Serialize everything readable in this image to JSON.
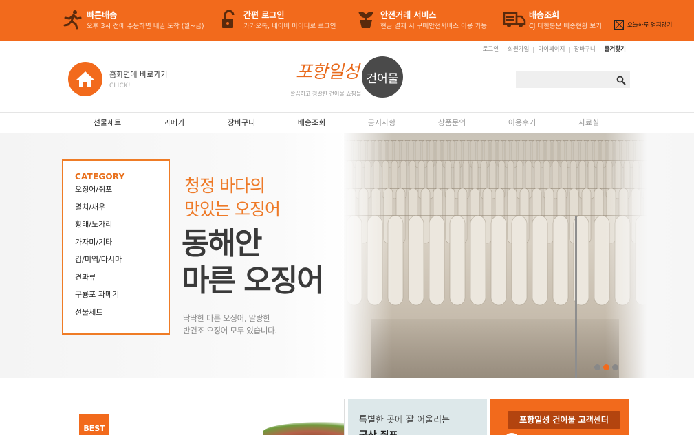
{
  "top_bar": {
    "features": [
      {
        "icon": "running-person-icon",
        "title": "빠른배송",
        "desc": "오후 3시 전에 주문하면 내일 도착 (월~금)"
      },
      {
        "icon": "padlock-icon",
        "title": "간편 로그인",
        "desc": "카카오톡, 네이버 아이디로 로그인"
      },
      {
        "icon": "plant-pot-icon",
        "title": "안전거래 서비스",
        "desc": "현금 결제 시 구매안전서비스 이용 가능"
      },
      {
        "icon": "delivery-truck-icon",
        "title": "배송조회",
        "desc": "CJ 대한통운 배송현황 보기"
      }
    ],
    "dismiss_label": "오늘하루 열지않기"
  },
  "util_links": [
    "로그인",
    "회원가입",
    "마이페이지",
    "장바구니",
    "즐겨찾기"
  ],
  "home_link": {
    "label": "홈화면에 바로가기",
    "sub": "CLICK!"
  },
  "logo": {
    "name": "포항일성",
    "badge": "건어물",
    "tagline": "깔끔하고 정갈한 건어물 쇼핑몰"
  },
  "search": {
    "placeholder": "",
    "value": ""
  },
  "nav": [
    "선물세트",
    "과메기",
    "장바구니",
    "배송조회",
    "공지사항",
    "상품문의",
    "이용후기",
    "자료실"
  ],
  "category": {
    "title": "CATEGORY",
    "items": [
      "오징어/쥐포",
      "멸치/새우",
      "황태/노가리",
      "가자미/기타",
      "김/미역/다시마",
      "견과류",
      "구룡포 과메기",
      "선물세트"
    ]
  },
  "hero": {
    "line1": "청정 바다의",
    "line2": "맛있는 오징어",
    "headline1": "동해안",
    "headline2": "마른 오징어",
    "desc1": "딱딱한 마른 오징어, 말랑한",
    "desc2": "반건조 오징어 모두 있습니다.",
    "slides": 3,
    "active_slide": 2
  },
  "boxes": {
    "best_label": "BEST",
    "special_line1": "특별한 곳에 잘 어울리는",
    "special_line2": "국산 쥐포",
    "service_title": "포항일성 건어물 고객센터"
  },
  "colors": {
    "brand": "#f26a1c",
    "brand_dark": "#b3440f",
    "text_dark": "#3a3a3a"
  }
}
